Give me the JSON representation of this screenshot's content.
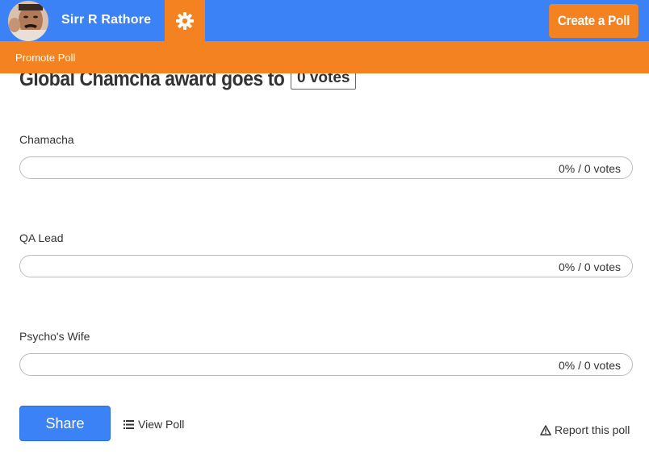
{
  "header": {
    "username": "Sirr R Rathore",
    "create_label": "Create a Poll",
    "avatar_icon": "avatar",
    "settings_icon": "gear-icon",
    "brand_blue": "#3b82f6",
    "brand_orange": "#f58220"
  },
  "promo": {
    "label": "Promote Poll"
  },
  "poll": {
    "title": "Global Chamcha award goes to",
    "total_votes": "0 votes",
    "options": [
      {
        "label": "Chamacha",
        "result": "0% / 0 votes",
        "percent": 0
      },
      {
        "label": "QA Lead",
        "result": "0% / 0 votes",
        "percent": 0
      },
      {
        "label": "Psycho's Wife",
        "result": "0% / 0 votes",
        "percent": 0
      }
    ]
  },
  "actions": {
    "share_label": "Share",
    "view_poll_label": "View Poll",
    "view_poll_icon": "list-icon",
    "report_label": "Report this poll",
    "report_icon": "warning-icon"
  }
}
